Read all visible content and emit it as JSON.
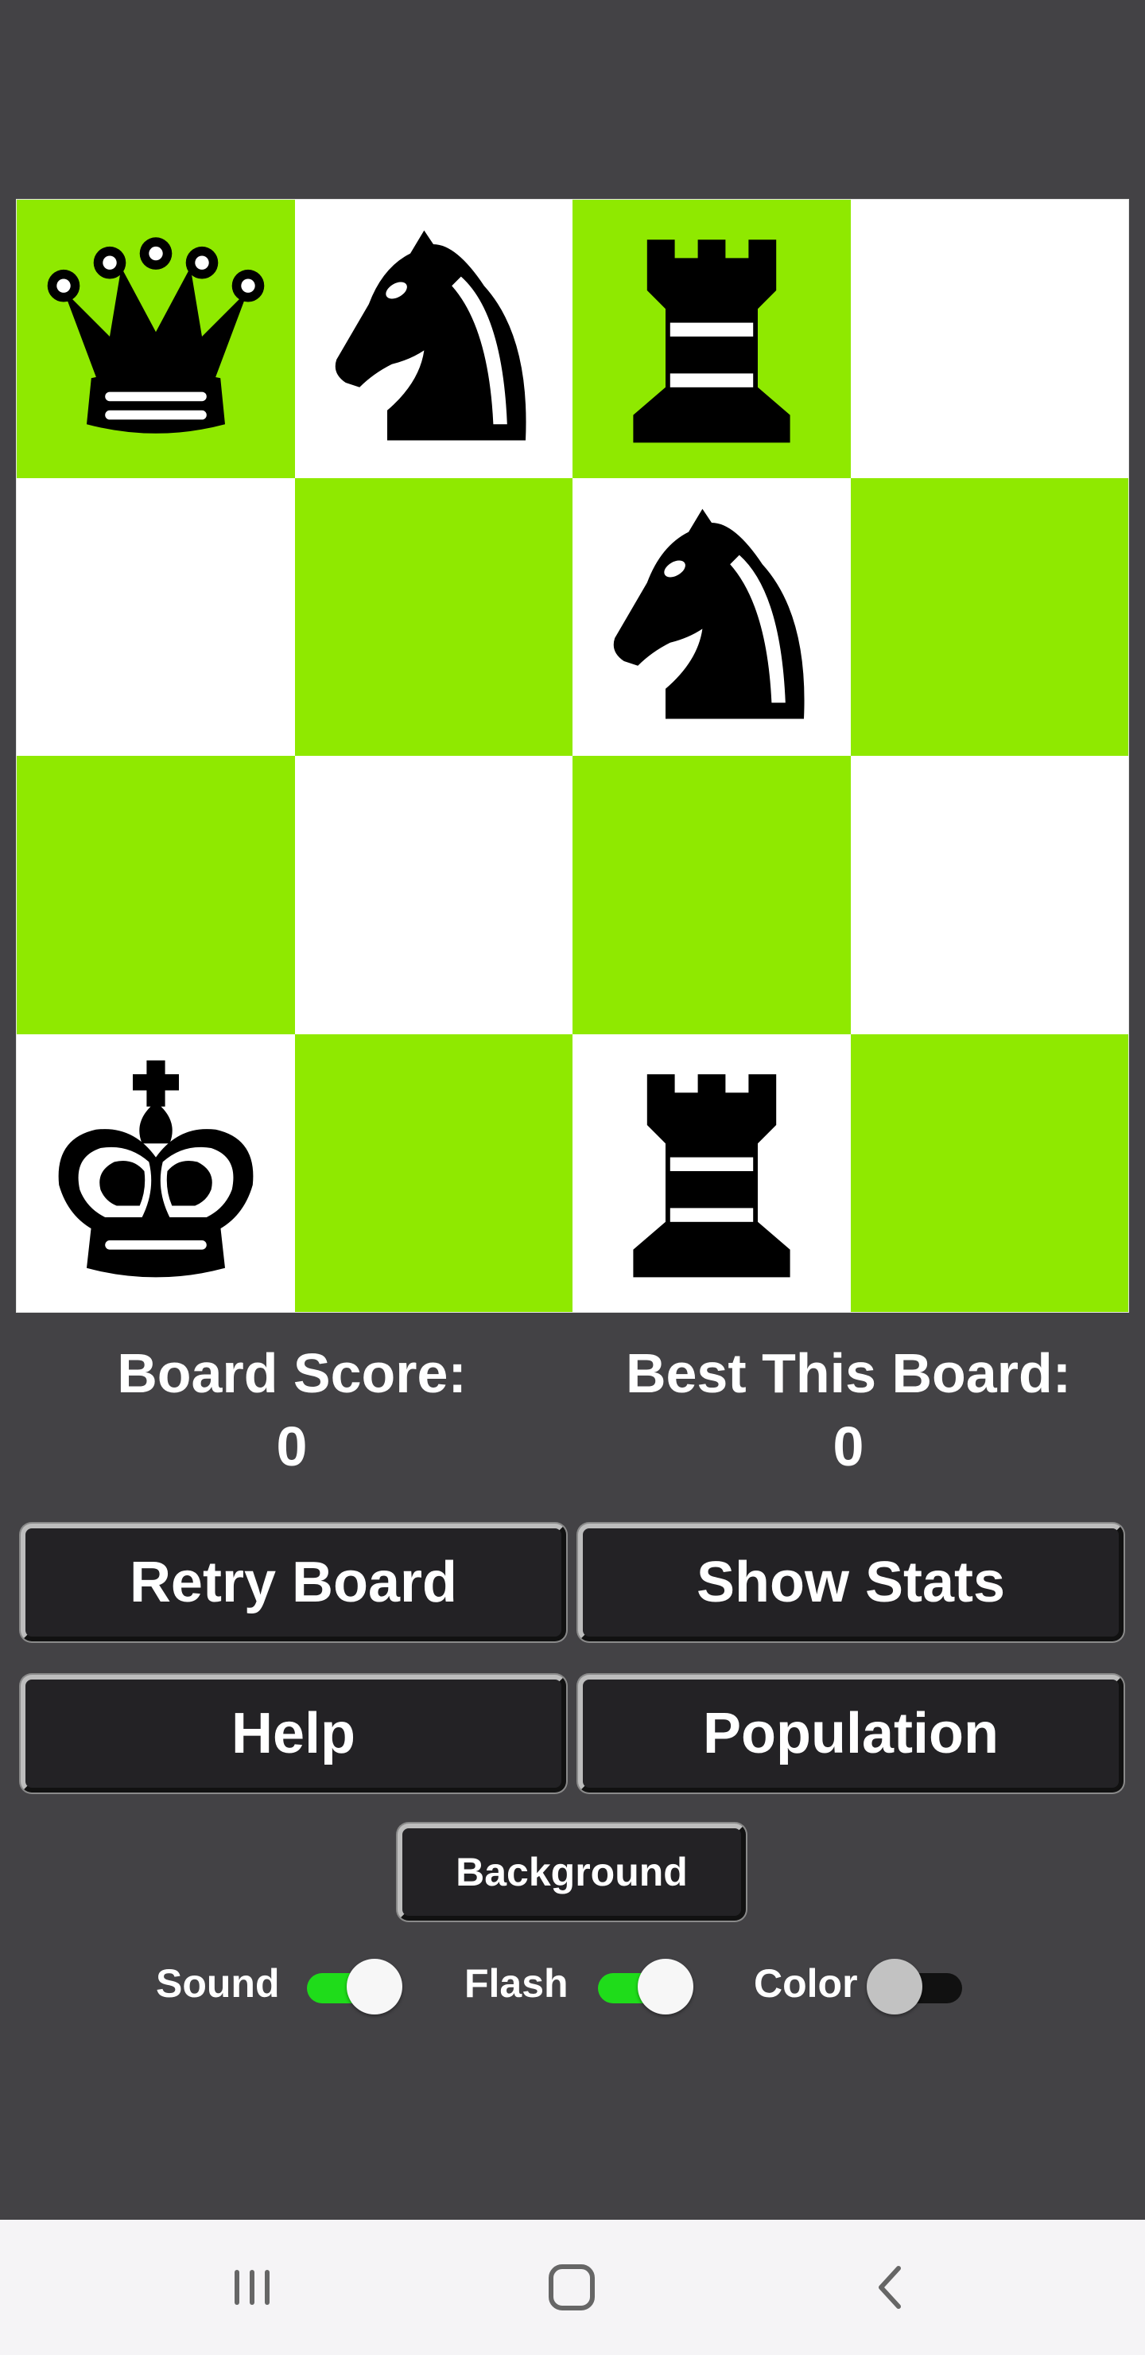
{
  "board": {
    "squares": [
      {
        "color": "dark",
        "piece": "queen-icon"
      },
      {
        "color": "light",
        "piece": "knight-icon"
      },
      {
        "color": "dark",
        "piece": "rook-icon"
      },
      {
        "color": "light",
        "piece": ""
      },
      {
        "color": "light",
        "piece": ""
      },
      {
        "color": "dark",
        "piece": ""
      },
      {
        "color": "light",
        "piece": "knight-icon"
      },
      {
        "color": "dark",
        "piece": ""
      },
      {
        "color": "dark",
        "piece": ""
      },
      {
        "color": "light",
        "piece": ""
      },
      {
        "color": "dark",
        "piece": ""
      },
      {
        "color": "light",
        "piece": ""
      },
      {
        "color": "light",
        "piece": "king-icon"
      },
      {
        "color": "dark",
        "piece": ""
      },
      {
        "color": "light",
        "piece": "rook-icon"
      },
      {
        "color": "dark",
        "piece": ""
      }
    ],
    "colors": {
      "light": "#ffffff",
      "dark": "#8fe900"
    }
  },
  "scores": {
    "board_score_label": "Board Score:",
    "board_score_value": "0",
    "best_label": "Best This Board:",
    "best_value": "0"
  },
  "buttons": {
    "retry": "Retry Board",
    "stats": "Show Stats",
    "help": "Help",
    "population": "Population",
    "background": "Background"
  },
  "toggles": {
    "sound_label": "Sound",
    "sound_on": true,
    "flash_label": "Flash",
    "flash_on": true,
    "color_label": "Color",
    "color_on": false
  },
  "navbar": {
    "recents": "recents-icon",
    "home": "home-icon",
    "back": "back-icon"
  }
}
